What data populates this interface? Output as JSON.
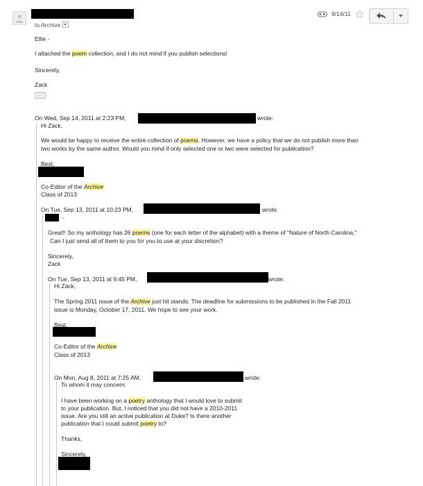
{
  "header": {
    "to_label": "to Archive",
    "date": "9/14/11"
  },
  "body": {
    "greeting": "Ellie -",
    "line1_pre": "I attached the ",
    "line1_hl": "poem",
    "line1_post": " collection, and I do not mind if you publish selections!",
    "closing": "Sincerely,",
    "signature": "Zack",
    "trimmed_indicator": "..."
  },
  "quote1": {
    "attribution": "On Wed, Sep 14, 2011 at 2:23 PM,",
    "wrote": "wrote:",
    "greeting": "Hi Zack,",
    "p1_pre": "We would be happy to receive the entire collection of ",
    "p1_hl": "poems",
    "p1_post": ". However, we have a policy that we do not publish more than",
    "p2": "two works by the same author. Would you mind if only selected one or two were selected for publication?",
    "closing": "Best,",
    "title_pre": "Co-Editor of the ",
    "title_hl": "Archive",
    "class": "Class of 2013"
  },
  "quote2": {
    "attribution": "On Tue, Sep 13, 2011 at 10:23 PM,",
    "wrote": "wrote:",
    "dash": "-",
    "p1_pre": "Great!!  So my anthology has 26 ",
    "p1_hl": "poems",
    "p1_post": " (one for each letter of the alphabet) with a theme of \"Nature of North Carolina.\"",
    "p2": "Can I just send all of them to you for you to use at your discretion?",
    "closing": "Sincerely,",
    "signature": "Zack"
  },
  "quote3": {
    "attribution": "On Tue, Sep 13, 2011 at 9:45 PM,",
    "wrote": "wrote:",
    "greeting": "Hi Zack,",
    "p1_pre": "The Spring 2011 issue of the ",
    "p1_hl": "Archive",
    "p1_post": " just hit stands. The deadline for submissions to be published in the Fall 2011",
    "p2": "issue is Monday, October 17, 2011. We hope to see your work.",
    "closing": "Best,",
    "title_pre": "Co-Editor of the ",
    "title_hl": "Archive",
    "class": "Class of 2013"
  },
  "quote4": {
    "attribution": "On Mon, Aug 8, 2011 at 7:25 AM,",
    "wrote": "wrote:",
    "greeting": "To whom it may concern:",
    "l1_pre": "I have been working on a ",
    "l1_hl": "poetry",
    "l1_post": " anthology that I would love to submit",
    "l2": "to your publication.  But, I noticed that you did not have a 2010-2011",
    "l3": "issue.  Are you still an active publication at Duke?  Is there another",
    "l4_pre": "publication that I could submit ",
    "l4_hl": "poetry",
    "l4_post": " to?",
    "thanks": "Thanks,",
    "closing": "Sincerely,"
  },
  "icons": {
    "avatar": "person-silhouette",
    "label": "tag-icon",
    "star": "star-outline",
    "reply": "reply-arrow",
    "more": "caret-down"
  }
}
